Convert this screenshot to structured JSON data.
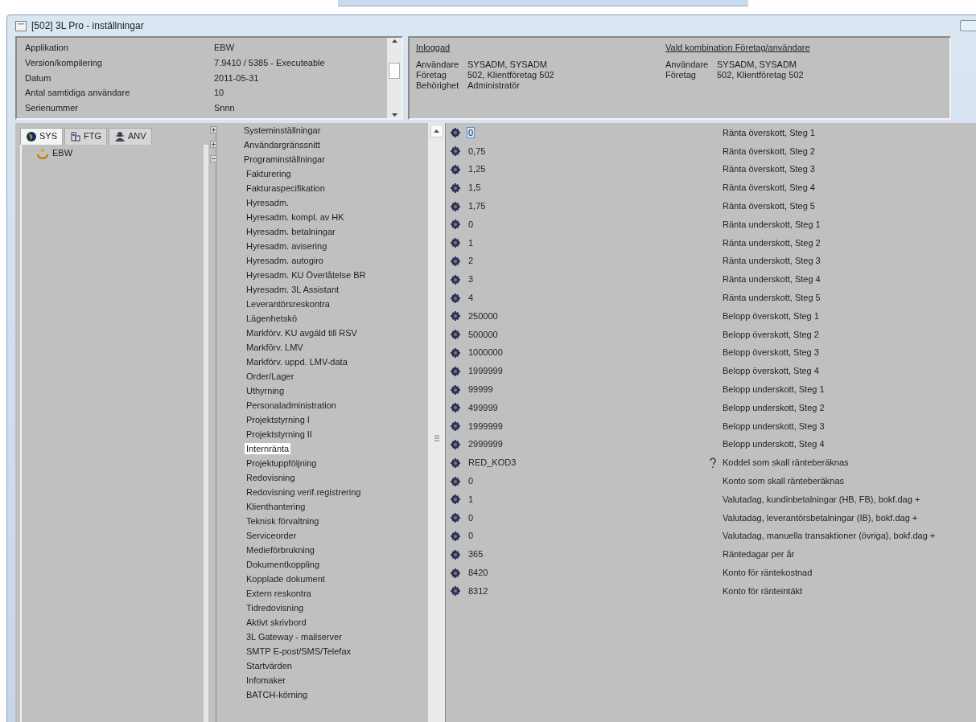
{
  "window": {
    "title": "[502]  3L Pro - inställningar"
  },
  "app_info": {
    "rows": [
      {
        "label": "Applikation",
        "value": "EBW"
      },
      {
        "label": "Version/kompilering",
        "value": "7.9410 / 5385 - Executeable"
      },
      {
        "label": "Datum",
        "value": "2011-05-31"
      },
      {
        "label": "Antal samtidiga användare",
        "value": "10"
      },
      {
        "label": "Serienummer",
        "value": "Snnn"
      }
    ]
  },
  "login_groups": [
    {
      "heading": "Inloggad",
      "rows": [
        {
          "label": "Användare",
          "value": "SYSADM, SYSADM"
        },
        {
          "label": "Företag",
          "value": "502, Klientföretag 502"
        },
        {
          "label": "Behörighet",
          "value": "Administratör"
        }
      ]
    },
    {
      "heading": "Vald kombination Företag/användare",
      "rows": [
        {
          "label": "Användare",
          "value": "SYSADM, SYSADM"
        },
        {
          "label": "Företag",
          "value": "502, Klientföretag 502"
        }
      ]
    }
  ],
  "tabs": [
    {
      "label": "SYS",
      "kind": "globe",
      "selected": true
    },
    {
      "label": "FTG",
      "kind": "building",
      "selected": false
    },
    {
      "label": "ANV",
      "kind": "person",
      "selected": false
    }
  ],
  "left_tree": [
    {
      "label": "EBW"
    }
  ],
  "settings_tree": [
    {
      "label": "Systeminställningar",
      "expanded": false
    },
    {
      "label": "Användargränssnitt",
      "expanded": false
    },
    {
      "label": "Programinställningar",
      "expanded": true,
      "children": [
        {
          "label": "Fakturering",
          "selected": false
        },
        {
          "label": "Fakturaspecifikation",
          "selected": false
        },
        {
          "label": "Hyresadm.",
          "selected": false
        },
        {
          "label": "Hyresadm. kompl. av HK",
          "selected": false
        },
        {
          "label": "Hyresadm. betalningar",
          "selected": false
        },
        {
          "label": "Hyresadm. avisering",
          "selected": false
        },
        {
          "label": "Hyresadm. autogiro",
          "selected": false
        },
        {
          "label": "Hyresadm. KU Överlåtelse BR",
          "selected": false
        },
        {
          "label": "Hyresadm. 3L Assistant",
          "selected": false
        },
        {
          "label": "Leverantörsreskontra",
          "selected": false
        },
        {
          "label": "Lägenhetskö",
          "selected": false
        },
        {
          "label": "Markförv. KU avgäld till RSV",
          "selected": false
        },
        {
          "label": "Markförv. LMV",
          "selected": false
        },
        {
          "label": "Markförv. uppd. LMV-data",
          "selected": false
        },
        {
          "label": "Order/Lager",
          "selected": false
        },
        {
          "label": "Uthyrning",
          "selected": false
        },
        {
          "label": "Personaladministration",
          "selected": false
        },
        {
          "label": "Projektstyrning I",
          "selected": false
        },
        {
          "label": "Projektstyrning II",
          "selected": false
        },
        {
          "label": "Internränta",
          "selected": true
        },
        {
          "label": "Projektuppföljning",
          "selected": false
        },
        {
          "label": "Redovisning",
          "selected": false
        },
        {
          "label": "Redovisning verif.registrering",
          "selected": false
        },
        {
          "label": "Klienthantering",
          "selected": false
        },
        {
          "label": "Teknisk förvaltning",
          "selected": false
        },
        {
          "label": "Serviceorder",
          "selected": false
        },
        {
          "label": "Medieförbrukning",
          "selected": false
        },
        {
          "label": "Dokumentkoppling",
          "selected": false
        },
        {
          "label": "Kopplade dokument",
          "selected": false
        },
        {
          "label": "Extern reskontra",
          "selected": false
        },
        {
          "label": "Tidredovisning",
          "selected": false
        },
        {
          "label": "Aktivt skrivbord",
          "selected": false
        },
        {
          "label": "3L Gateway - mailserver",
          "selected": false
        },
        {
          "label": "SMTP E-post/SMS/Telefax",
          "selected": false
        },
        {
          "label": "Startvärden",
          "selected": false
        },
        {
          "label": "Infomaker",
          "selected": false
        },
        {
          "label": "BATCH-körning",
          "selected": false
        }
      ]
    }
  ],
  "settings": [
    {
      "value": "0",
      "description": "Ränta överskott, Steg 1",
      "focused": true,
      "hint": false
    },
    {
      "value": "0,75",
      "description": "Ränta överskott, Steg 2",
      "focused": false,
      "hint": false
    },
    {
      "value": "1,25",
      "description": "Ränta överskott, Steg 3",
      "focused": false,
      "hint": false
    },
    {
      "value": "1,5",
      "description": "Ränta överskott, Steg 4",
      "focused": false,
      "hint": false
    },
    {
      "value": "1,75",
      "description": "Ränta överskott, Steg 5",
      "focused": false,
      "hint": false
    },
    {
      "value": "0",
      "description": "Ränta underskott, Steg 1",
      "focused": false,
      "hint": false
    },
    {
      "value": "1",
      "description": "Ränta underskott, Steg 2",
      "focused": false,
      "hint": false
    },
    {
      "value": "2",
      "description": "Ränta underskott, Steg 3",
      "focused": false,
      "hint": false
    },
    {
      "value": "3",
      "description": "Ränta underskott, Steg 4",
      "focused": false,
      "hint": false
    },
    {
      "value": "4",
      "description": "Ränta underskott, Steg 5",
      "focused": false,
      "hint": false
    },
    {
      "value": "250000",
      "description": "Belopp överskott, Steg 1",
      "focused": false,
      "hint": false
    },
    {
      "value": "500000",
      "description": "Belopp överskott, Steg 2",
      "focused": false,
      "hint": false
    },
    {
      "value": "1000000",
      "description": "Belopp överskott, Steg 3",
      "focused": false,
      "hint": false
    },
    {
      "value": "1999999",
      "description": "Belopp överskott, Steg 4",
      "focused": false,
      "hint": false
    },
    {
      "value": "99999",
      "description": "Belopp underskott, Steg 1",
      "focused": false,
      "hint": false
    },
    {
      "value": "499999",
      "description": "Belopp underskott, Steg 2",
      "focused": false,
      "hint": false
    },
    {
      "value": "1999999",
      "description": "Belopp underskott, Steg 3",
      "focused": false,
      "hint": false
    },
    {
      "value": "2999999",
      "description": "Belopp underskott, Steg 4",
      "focused": false,
      "hint": false
    },
    {
      "value": "RED_KOD3",
      "description": "Koddel som skall ränteberäknas",
      "focused": false,
      "hint": true
    },
    {
      "value": "0",
      "description": "Konto som skall ränteberäknas",
      "focused": false,
      "hint": false
    },
    {
      "value": "1",
      "description": "Valutadag, kundinbetalningar (HB, FB), bokf.dag +",
      "focused": false,
      "hint": false
    },
    {
      "value": "0",
      "description": "Valutadag, leverantörsbetalningar (IB), bokf.dag +",
      "focused": false,
      "hint": false
    },
    {
      "value": "0",
      "description": "Valutadag, manuella transaktioner (övriga), bokf.dag +",
      "focused": false,
      "hint": false
    },
    {
      "value": "365",
      "description": "Räntedagar per år",
      "focused": false,
      "hint": false
    },
    {
      "value": "8420",
      "description": "Konto för räntekostnad",
      "focused": false,
      "hint": false
    },
    {
      "value": "8312",
      "description": "Konto för ränteintäkt",
      "focused": false,
      "hint": false
    }
  ]
}
